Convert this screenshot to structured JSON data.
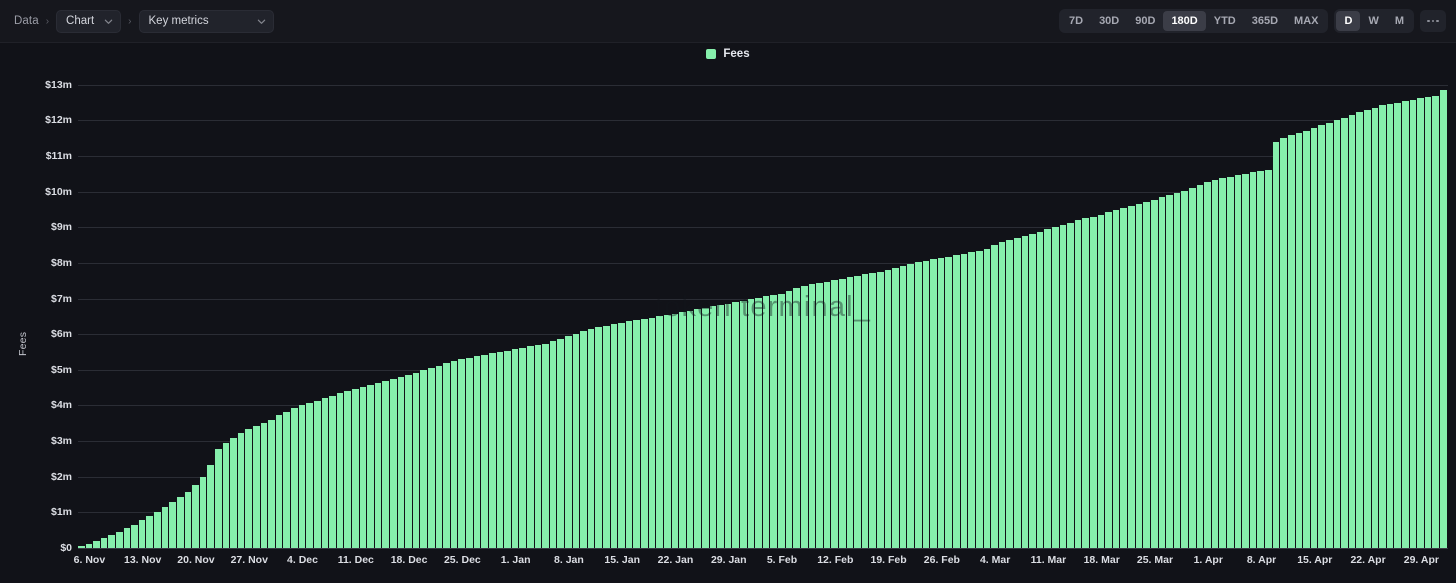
{
  "breadcrumb": {
    "root_label": "Data",
    "separator": "›",
    "chart_label": "Chart",
    "metrics_label": "Key metrics"
  },
  "range_controls": {
    "periods": [
      "7D",
      "30D",
      "90D",
      "180D",
      "YTD",
      "365D",
      "MAX"
    ],
    "active_period": "180D",
    "granularity": [
      "D",
      "W",
      "M"
    ],
    "active_granularity": "D",
    "more_label": "more-options"
  },
  "legend": {
    "label": "Fees",
    "color": "#86efac"
  },
  "chart_data": {
    "type": "bar",
    "title": "",
    "xlabel": "",
    "ylabel": "Fees",
    "ylim": [
      0,
      13.5
    ],
    "grid": true,
    "legend_position": "top-center",
    "watermark": "token terminal_",
    "bar_color": "#86efac",
    "y_tick_labels": [
      "$13m",
      "$12m",
      "$11m",
      "$10m",
      "$9m",
      "$8m",
      "$7m",
      "$6m",
      "$5m",
      "$4m",
      "$3m",
      "$2m",
      "$1m",
      "$0"
    ],
    "y_tick_values": [
      13,
      12,
      11,
      10,
      9,
      8,
      7,
      6,
      5,
      4,
      3,
      2,
      1,
      0
    ],
    "x_tick_labels": [
      "6. Nov",
      "13. Nov",
      "20. Nov",
      "27. Nov",
      "4. Dec",
      "11. Dec",
      "18. Dec",
      "25. Dec",
      "1. Jan",
      "8. Jan",
      "15. Jan",
      "22. Jan",
      "29. Jan",
      "5. Feb",
      "12. Feb",
      "19. Feb",
      "26. Feb",
      "4. Mar",
      "11. Mar",
      "18. Mar",
      "25. Mar",
      "1. Apr",
      "8. Apr",
      "15. Apr",
      "22. Apr",
      "29. Apr"
    ],
    "x_tick_indices": [
      1,
      8,
      15,
      22,
      29,
      36,
      43,
      50,
      57,
      64,
      71,
      78,
      85,
      92,
      99,
      106,
      113,
      120,
      127,
      134,
      141,
      148,
      155,
      162,
      169,
      176
    ],
    "unit": "millions USD",
    "series_name": "Fees",
    "values": [
      0.05,
      0.12,
      0.2,
      0.28,
      0.36,
      0.45,
      0.55,
      0.66,
      0.78,
      0.9,
      1.02,
      1.14,
      1.28,
      1.42,
      1.58,
      1.78,
      2.0,
      2.32,
      2.78,
      2.96,
      3.1,
      3.22,
      3.33,
      3.42,
      3.5,
      3.6,
      3.72,
      3.82,
      3.92,
      4.0,
      4.06,
      4.12,
      4.2,
      4.28,
      4.34,
      4.4,
      4.46,
      4.52,
      4.58,
      4.64,
      4.7,
      4.74,
      4.8,
      4.86,
      4.92,
      5.0,
      5.06,
      5.12,
      5.2,
      5.26,
      5.3,
      5.34,
      5.38,
      5.42,
      5.46,
      5.5,
      5.54,
      5.58,
      5.62,
      5.66,
      5.7,
      5.74,
      5.8,
      5.86,
      5.94,
      6.02,
      6.08,
      6.14,
      6.2,
      6.24,
      6.28,
      6.32,
      6.36,
      6.4,
      6.44,
      6.46,
      6.5,
      6.54,
      6.58,
      6.62,
      6.66,
      6.7,
      6.74,
      6.78,
      6.82,
      6.86,
      6.9,
      6.94,
      6.98,
      7.02,
      7.06,
      7.1,
      7.14,
      7.2,
      7.3,
      7.36,
      7.4,
      7.44,
      7.48,
      7.52,
      7.56,
      7.6,
      7.64,
      7.68,
      7.72,
      7.76,
      7.8,
      7.86,
      7.92,
      7.98,
      8.02,
      8.06,
      8.1,
      8.14,
      8.18,
      8.22,
      8.26,
      8.3,
      8.34,
      8.4,
      8.5,
      8.58,
      8.64,
      8.7,
      8.76,
      8.82,
      8.88,
      8.94,
      9.0,
      9.06,
      9.12,
      9.2,
      9.26,
      9.3,
      9.36,
      9.42,
      9.48,
      9.54,
      9.6,
      9.66,
      9.72,
      9.78,
      9.84,
      9.9,
      9.96,
      10.02,
      10.1,
      10.2,
      10.28,
      10.34,
      10.38,
      10.42,
      10.46,
      10.5,
      10.54,
      10.58,
      10.62,
      11.4,
      11.5,
      11.58,
      11.64,
      11.7,
      11.78,
      11.86,
      11.94,
      12.0,
      12.08,
      12.16,
      12.24,
      12.3,
      12.36,
      12.42,
      12.46,
      12.5,
      12.54,
      12.58,
      12.62,
      12.66,
      12.7,
      12.85
    ]
  }
}
